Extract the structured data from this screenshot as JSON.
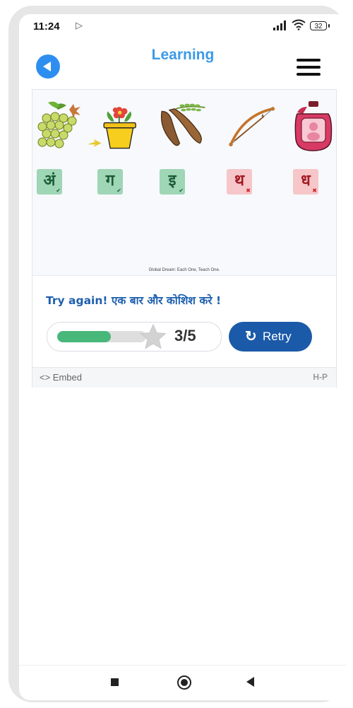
{
  "status_bar": {
    "time": "11:24",
    "battery": "32"
  },
  "app_bar": {
    "title": "Learning"
  },
  "activity": {
    "pictures": [
      "grapes",
      "flower-pot",
      "tamarind",
      "bow-and-arrow",
      "flask"
    ],
    "letters": [
      {
        "char": "अं",
        "correct": true
      },
      {
        "char": "ग",
        "correct": true
      },
      {
        "char": "इ",
        "correct": true
      },
      {
        "char": "थ",
        "correct": false
      },
      {
        "char": "ध",
        "correct": false
      }
    ],
    "credit": "Global Dream: Each One, Teach One."
  },
  "feedback": "Try again! एक बार और कोशिश करे !",
  "score": {
    "text": "3/5",
    "value": 3,
    "max": 5,
    "fraction": 0.6
  },
  "retry_label": "Retry",
  "footer": {
    "embed_label": "<> Embed",
    "brand": "H-P"
  },
  "colors": {
    "accent": "#3d9ae8",
    "primary_button": "#1b5aa8",
    "correct": "#9fd6b6",
    "incorrect": "#f6c6c9",
    "progress": "#48b87a"
  }
}
